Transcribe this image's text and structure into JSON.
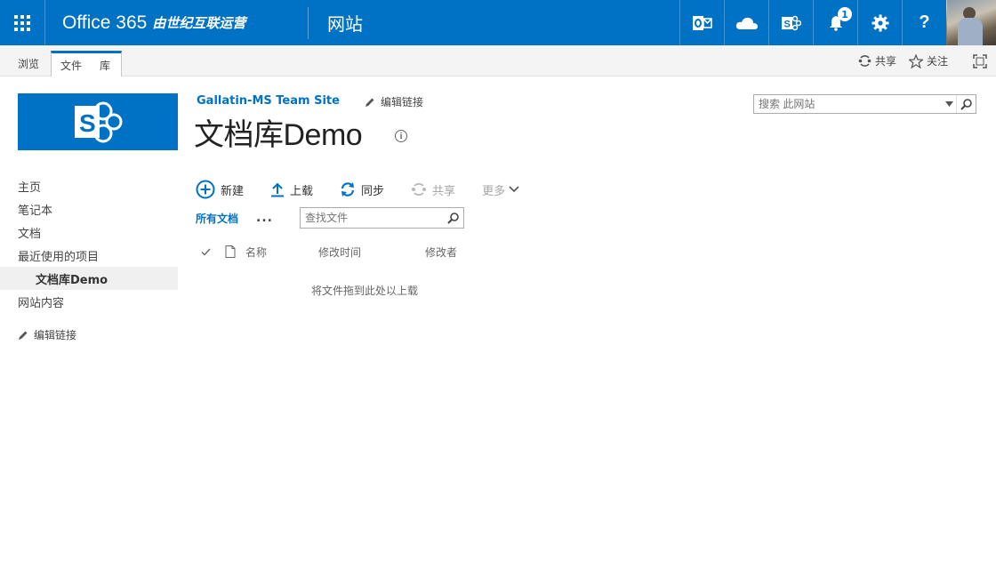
{
  "suite": {
    "brand": "Office 365",
    "brand_operator": "由世纪互联运营",
    "site_label": "网站",
    "notification_count": "1",
    "icons": [
      "waffle-icon",
      "outlook-icon",
      "onedrive-icon",
      "sharepoint-icon",
      "bell-icon",
      "gear-icon",
      "help-icon"
    ],
    "help_label": "?"
  },
  "ribbon": {
    "browse": "浏览",
    "tab_file": "文件",
    "tab_library": "库",
    "share": "共享",
    "follow": "关注"
  },
  "site": {
    "title": "Gallatin-MS Team Site",
    "edit_links": "编辑链接",
    "search_placeholder": "搜索 此网站"
  },
  "page": {
    "title": "文档库Demo",
    "info": "i"
  },
  "nav": {
    "items": [
      "主页",
      "笔记本",
      "文档",
      "最近使用的项目"
    ],
    "current": "文档库Demo",
    "site_contents": "网站内容",
    "edit_links": "编辑链接"
  },
  "commands": {
    "new": "新建",
    "upload": "上载",
    "sync": "同步",
    "share": "共享",
    "more": "更多"
  },
  "view": {
    "name": "所有文档",
    "ellipsis": "...",
    "find_placeholder": "查找文件"
  },
  "columns": {
    "name": "名称",
    "modified": "修改时间",
    "modified_by": "修改者"
  },
  "empty_hint": "将文件拖到此处以上载",
  "colors": {
    "brand_blue": "#0072c6",
    "link_blue": "#0072c6",
    "disabled": "#a6a6a6"
  }
}
